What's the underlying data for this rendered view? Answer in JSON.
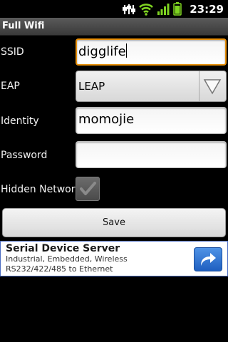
{
  "statusbar": {
    "time": "23:29",
    "icons": [
      "usb-debug-icon",
      "wifi-icon",
      "signal-icon",
      "battery-icon"
    ]
  },
  "title": "Full Wifi",
  "form": {
    "ssid_label": "SSID",
    "ssid_value": "digglife",
    "eap_label": "EAP",
    "eap_value": "LEAP",
    "identity_label": "Identity",
    "identity_value": "momojie",
    "password_label": "Password",
    "password_value": "",
    "hidden_label": "Hidden Network",
    "hidden_checked": true,
    "save_label": "Save"
  },
  "ad": {
    "title": "Serial Device Server",
    "description": "Industrial, Embedded, Wireless RS232/422/485 to Ethernet",
    "button_icon": "share-arrow-icon",
    "button_color": "#2f74d6",
    "border_color": "#4a6cc2"
  },
  "colors": {
    "focus_border": "#e8900a",
    "title_bar": "#4a4a4a",
    "background": "#000000"
  }
}
